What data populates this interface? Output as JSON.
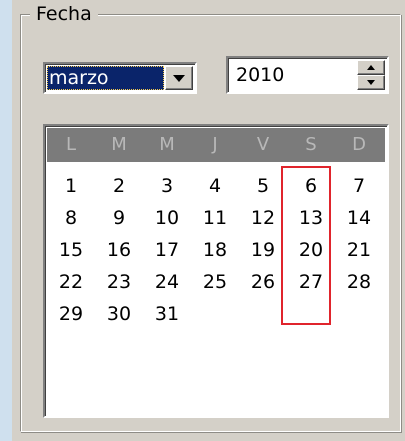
{
  "groupbox": {
    "title": "Fecha"
  },
  "month_select": {
    "value": "marzo"
  },
  "year_spinner": {
    "value": "2010"
  },
  "calendar": {
    "weekday_headers": [
      "L",
      "M",
      "M",
      "J",
      "V",
      "S",
      "D"
    ],
    "weeks": [
      [
        "1",
        "2",
        "3",
        "4",
        "5",
        "6",
        "7"
      ],
      [
        "8",
        "9",
        "10",
        "11",
        "12",
        "13",
        "14"
      ],
      [
        "15",
        "16",
        "17",
        "18",
        "19",
        "20",
        "21"
      ],
      [
        "22",
        "23",
        "24",
        "25",
        "26",
        "27",
        "28"
      ],
      [
        "29",
        "30",
        "31",
        "",
        "",
        "",
        ""
      ]
    ],
    "highlight_color": "#e0242c",
    "header_bg": "#7b7b7b"
  },
  "icons": {
    "combo_arrow": "chevron-down-icon",
    "spin_up": "arrow-up-icon",
    "spin_down": "arrow-down-icon"
  }
}
